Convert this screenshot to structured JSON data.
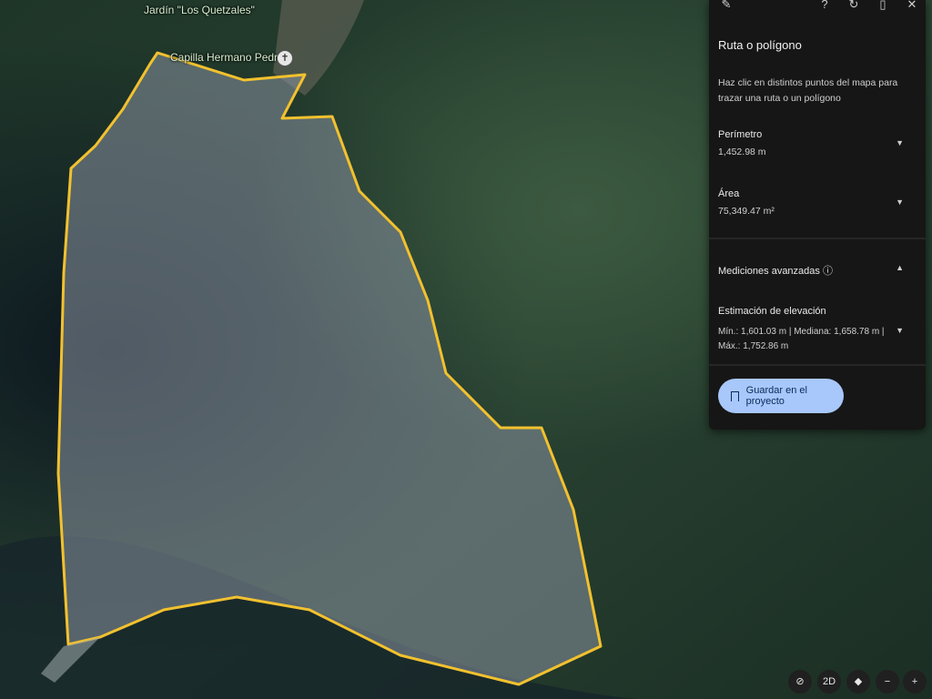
{
  "map": {
    "labels": {
      "garden": "Jardín \"Los Quetzales\"",
      "chapel": "Capilla Hermano Pedro"
    },
    "polygon_color": "#f2c12e",
    "chapel_pin_icon": "cross-pin-icon"
  },
  "panel": {
    "toolbar": {
      "measure_icon": "ruler-icon",
      "help_icon": "help-icon",
      "undo_icon": "undo-icon",
      "delete_icon": "trash-icon",
      "close_icon": "close-icon"
    },
    "title": "Ruta o polígono",
    "help_text": "Haz clic en distintos puntos del mapa para trazar una ruta o un polígono",
    "perimeter": {
      "label": "Perímetro",
      "value": "1,452.98 m"
    },
    "area": {
      "label": "Área",
      "value": "75,349.47 m²"
    },
    "advanced": {
      "label": "Mediciones avanzadas ⓘ"
    },
    "elevation": {
      "label": "Estimación de elevación",
      "values": "Mín.: 1,601.03 m | Mediana: 1,658.78 m | Máx.: 1,752.86 m"
    },
    "save_button": "Guardar en el proyecto"
  },
  "controls": {
    "compass_icon": "compass-icon",
    "view_2d": "2D",
    "pegman_icon": "street-view-icon",
    "zoom_out": "−",
    "zoom_in": "+"
  }
}
